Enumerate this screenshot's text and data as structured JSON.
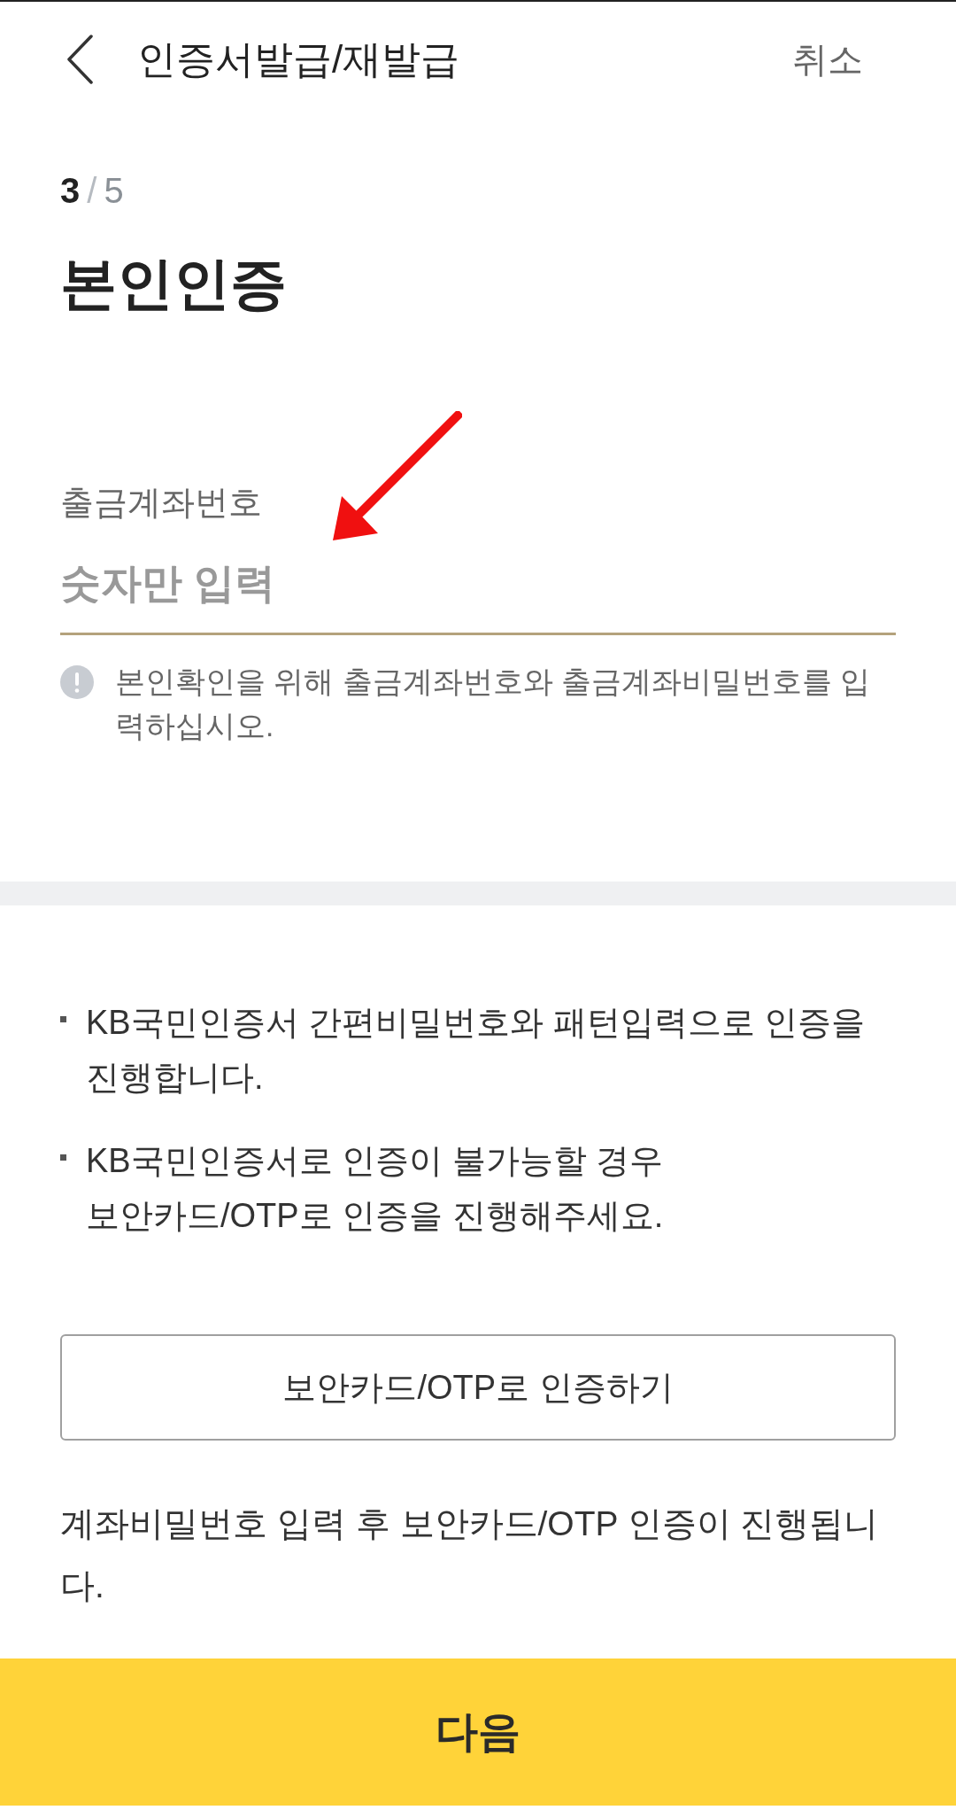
{
  "header": {
    "title": "인증서발급/재발급",
    "cancel_label": "취소"
  },
  "step": {
    "current": "3",
    "separator": "/",
    "total": "5"
  },
  "heading": "본인인증",
  "account_field": {
    "label": "출금계좌번호",
    "placeholder": "숫자만 입력"
  },
  "hint": "본인확인을 위해 출금계좌번호와 출금계좌비밀번호를 입력하십시오.",
  "notices": [
    "KB국민인증서 간편비밀번호와 패턴입력으로 인증을 진행합니다.",
    "KB국민인증서로 인증이 불가능할 경우 보안카드/OTP로 인증을 진행해주세요."
  ],
  "alt_button": {
    "label": "보안카드/OTP로 인증하기"
  },
  "note": "계좌비밀번호 입력 후 보안카드/OTP 인증이 진행됩니다.",
  "next_button": {
    "label": "다음"
  }
}
